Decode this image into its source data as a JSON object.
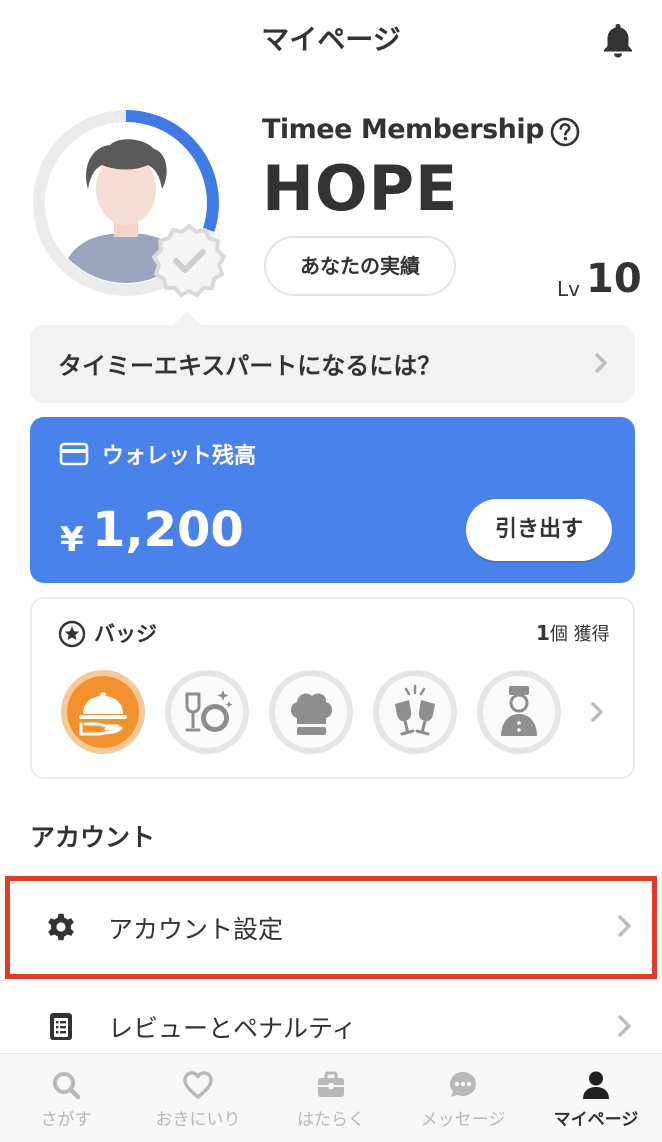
{
  "header": {
    "title": "マイページ"
  },
  "membership": {
    "title": "Timee Membership",
    "rank": "HOPE",
    "achievement_button": "あなたの実績",
    "level_label": "Lv",
    "level_value": "10",
    "progress": 0.3
  },
  "expert_banner": {
    "text": "タイミーエキスパートになるには？"
  },
  "wallet": {
    "label": "ウォレット残高",
    "currency": "¥",
    "amount": "1,200",
    "withdraw_button": "引き出す"
  },
  "badges": {
    "label": "バッジ",
    "count": "1",
    "count_suffix": "個 獲得",
    "items": [
      {
        "icon": "cloche-serving-icon",
        "earned": true
      },
      {
        "icon": "wine-glass-plate-icon",
        "earned": false
      },
      {
        "icon": "chef-hat-icon",
        "earned": false
      },
      {
        "icon": "toast-glasses-icon",
        "earned": false
      },
      {
        "icon": "bellhop-icon",
        "earned": false
      }
    ]
  },
  "account": {
    "section_title": "アカウント",
    "items": [
      {
        "label": "アカウント設定",
        "icon": "gear-icon"
      },
      {
        "label": "レビューとペナルティ",
        "icon": "clipboard-icon"
      }
    ]
  },
  "tabbar": {
    "items": [
      {
        "label": "さがす",
        "icon": "search-icon",
        "active": false
      },
      {
        "label": "おきにいり",
        "icon": "heart-icon",
        "active": false
      },
      {
        "label": "はたらく",
        "icon": "briefcase-icon",
        "active": false
      },
      {
        "label": "メッセージ",
        "icon": "message-icon",
        "active": false
      },
      {
        "label": "マイページ",
        "icon": "person-icon",
        "active": true
      }
    ]
  },
  "colors": {
    "accent": "#4a82ec",
    "highlight": "#e53b22",
    "badge_earned": "#f3922d",
    "badge_inactive": "#9a9a9a"
  }
}
